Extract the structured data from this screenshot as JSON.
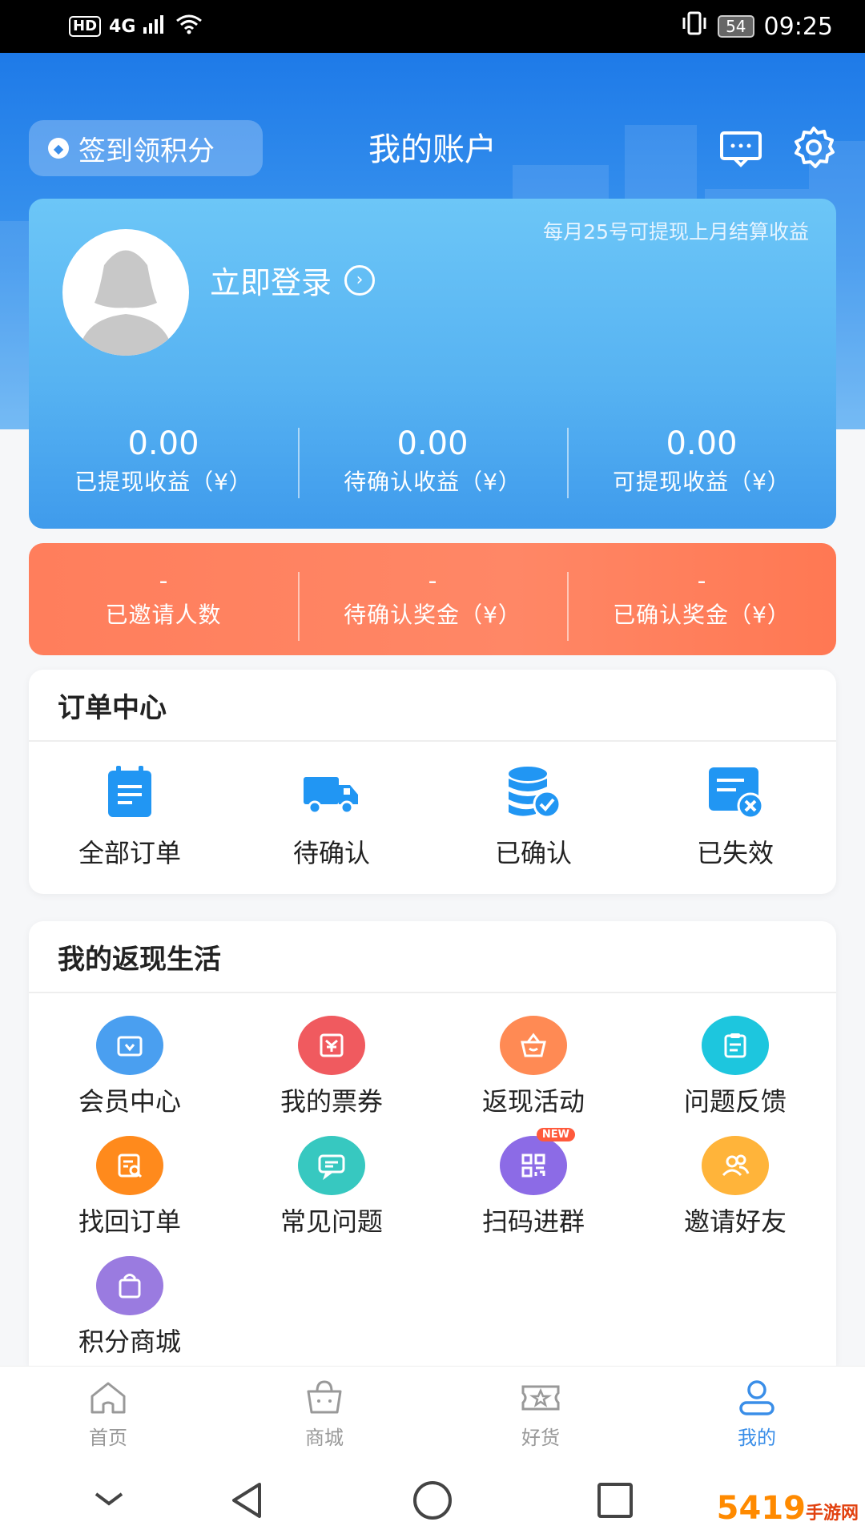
{
  "status_bar": {
    "hd": "HD",
    "network": "4G",
    "battery": "54",
    "time": "09:25"
  },
  "header": {
    "signin_label": "签到领积分",
    "title": "我的账户",
    "message_icon": "message-icon",
    "settings_icon": "gear-icon"
  },
  "account": {
    "note": "每月25号可提现上月结算收益",
    "login_label": "立即登录",
    "stats": [
      {
        "value": "0.00",
        "label": "已提现收益（¥）"
      },
      {
        "value": "0.00",
        "label": "待确认收益（¥）"
      },
      {
        "value": "0.00",
        "label": "可提现收益（¥）"
      }
    ]
  },
  "invite": {
    "stats": [
      {
        "value": "-",
        "label": "已邀请人数"
      },
      {
        "value": "-",
        "label": "待确认奖金（¥）"
      },
      {
        "value": "-",
        "label": "已确认奖金（¥）"
      }
    ]
  },
  "orders": {
    "title": "订单中心",
    "items": [
      {
        "label": "全部订单",
        "icon": "clipboard-icon"
      },
      {
        "label": "待确认",
        "icon": "truck-icon"
      },
      {
        "label": "已确认",
        "icon": "coins-check-icon"
      },
      {
        "label": "已失效",
        "icon": "card-x-icon"
      }
    ]
  },
  "cashback": {
    "title": "我的返现生活",
    "items": [
      {
        "label": "会员中心",
        "icon": "vip-icon",
        "color": "#4a9ff0"
      },
      {
        "label": "我的票券",
        "icon": "ticket-icon",
        "color": "#f05a5f"
      },
      {
        "label": "返现活动",
        "icon": "basket-icon",
        "color": "#ff8a54"
      },
      {
        "label": "问题反馈",
        "icon": "feedback-icon",
        "color": "#1dc6de"
      },
      {
        "label": "找回订单",
        "icon": "find-order-icon",
        "color": "#ff8a1c"
      },
      {
        "label": "常见问题",
        "icon": "chat-icon",
        "color": "#37c8c0"
      },
      {
        "label": "扫码进群",
        "icon": "qrcode-icon",
        "color": "#8c6be6",
        "badge": "NEW"
      },
      {
        "label": "邀请好友",
        "icon": "friends-icon",
        "color": "#ffb43a"
      },
      {
        "label": "积分商城",
        "icon": "shopping-bag-icon",
        "color": "#9a7be0"
      }
    ]
  },
  "bottom_nav": [
    {
      "label": "首页",
      "icon": "home-icon",
      "active": false
    },
    {
      "label": "商城",
      "icon": "mall-bag-icon",
      "active": false
    },
    {
      "label": "好货",
      "icon": "star-ticket-icon",
      "active": false
    },
    {
      "label": "我的",
      "icon": "person-icon",
      "active": true
    }
  ],
  "watermark": {
    "brand": "5419",
    "sub": "手游网"
  },
  "colors": {
    "primary": "#3a8ee8",
    "orange": "#ff7e5c",
    "inactive": "#999999"
  }
}
